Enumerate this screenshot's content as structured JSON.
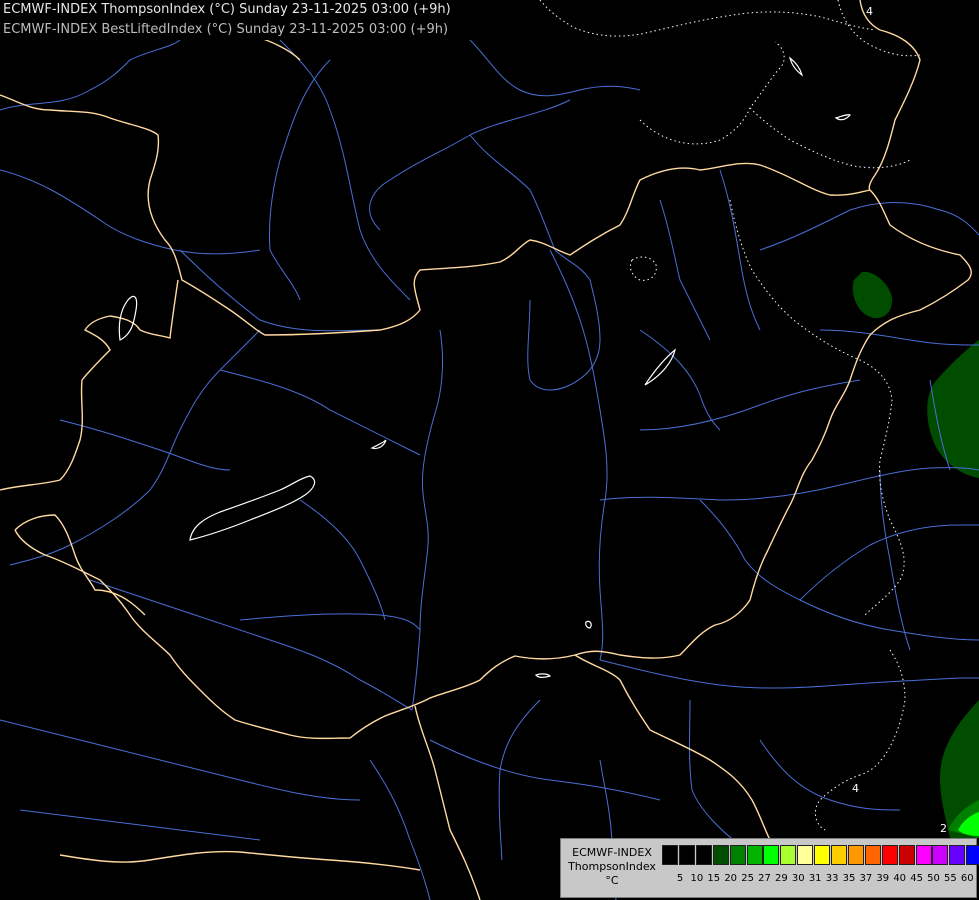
{
  "title": {
    "line1": "ECMWF-INDEX ThompsonIndex (°C) Sunday 23-11-2025 03:00 (+9h)",
    "line2": "ECMWF-INDEX BestLiftedIndex (°C) Sunday 23-11-2025 03:00 (+9h)"
  },
  "legend": {
    "model": "ECMWF-INDEX",
    "parameter": "ThompsonIndex",
    "unit": "°C",
    "bins": [
      {
        "value": "5",
        "color": "#000000"
      },
      {
        "value": "10",
        "color": "#000000"
      },
      {
        "value": "15",
        "color": "#000000"
      },
      {
        "value": "20",
        "color": "#004d00"
      },
      {
        "value": "25",
        "color": "#008000"
      },
      {
        "value": "27",
        "color": "#00b300"
      },
      {
        "value": "29",
        "color": "#00ff00"
      },
      {
        "value": "30",
        "color": "#aaff33"
      },
      {
        "value": "31",
        "color": "#ffff99"
      },
      {
        "value": "33",
        "color": "#ffff00"
      },
      {
        "value": "35",
        "color": "#ffcc00"
      },
      {
        "value": "37",
        "color": "#ff9900"
      },
      {
        "value": "39",
        "color": "#ff6600"
      },
      {
        "value": "40",
        "color": "#ff0000"
      },
      {
        "value": "45",
        "color": "#cc0000"
      },
      {
        "value": "50",
        "color": "#ff00ff"
      },
      {
        "value": "55",
        "color": "#cc00ff"
      },
      {
        "value": "60",
        "color": "#6600ff"
      },
      {
        "value": "",
        "color": "#0000ff"
      }
    ]
  },
  "contour_labels": [
    "4",
    "4",
    "2"
  ],
  "colors": {
    "background": "#000000",
    "border": "#ffd9a0",
    "river": "#4a6fd6",
    "lake": "#ffffff",
    "contour": "#ffffff",
    "fill_dark": "#004d00",
    "fill_mid": "#008000",
    "fill_bright": "#00ff00"
  }
}
